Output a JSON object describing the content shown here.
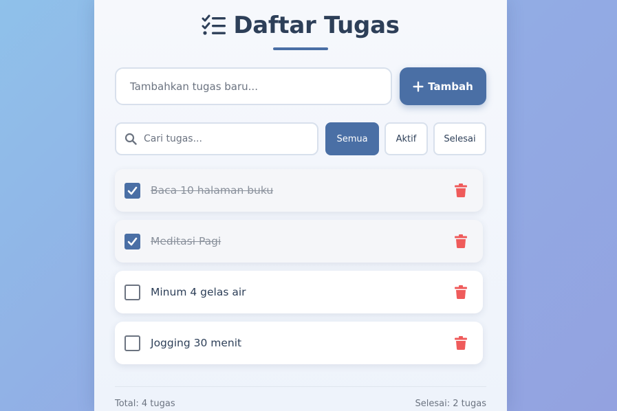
{
  "header": {
    "title": "Daftar Tugas",
    "icon": "task-list-icon"
  },
  "add": {
    "placeholder": "Tambahkan tugas baru...",
    "button_label": "Tambah",
    "button_icon": "plus-icon"
  },
  "search": {
    "placeholder": "Cari tugas...",
    "icon": "search-icon"
  },
  "filters": [
    {
      "label": "Semua",
      "active": true
    },
    {
      "label": "Aktif",
      "active": false
    },
    {
      "label": "Selesai",
      "active": false
    }
  ],
  "tasks": [
    {
      "text": "Baca 10 halaman buku",
      "done": true
    },
    {
      "text": "Meditasi Pagi",
      "done": true
    },
    {
      "text": "Minum 4 gelas air",
      "done": false
    },
    {
      "text": "Jogging 30 menit",
      "done": false
    }
  ],
  "footer": {
    "total": "Total: 4 tugas",
    "done": "Selesai: 2 tugas"
  },
  "colors": {
    "accent": "#4a6fa5",
    "title": "#2d3f58",
    "delete": "#ef5b5b"
  }
}
